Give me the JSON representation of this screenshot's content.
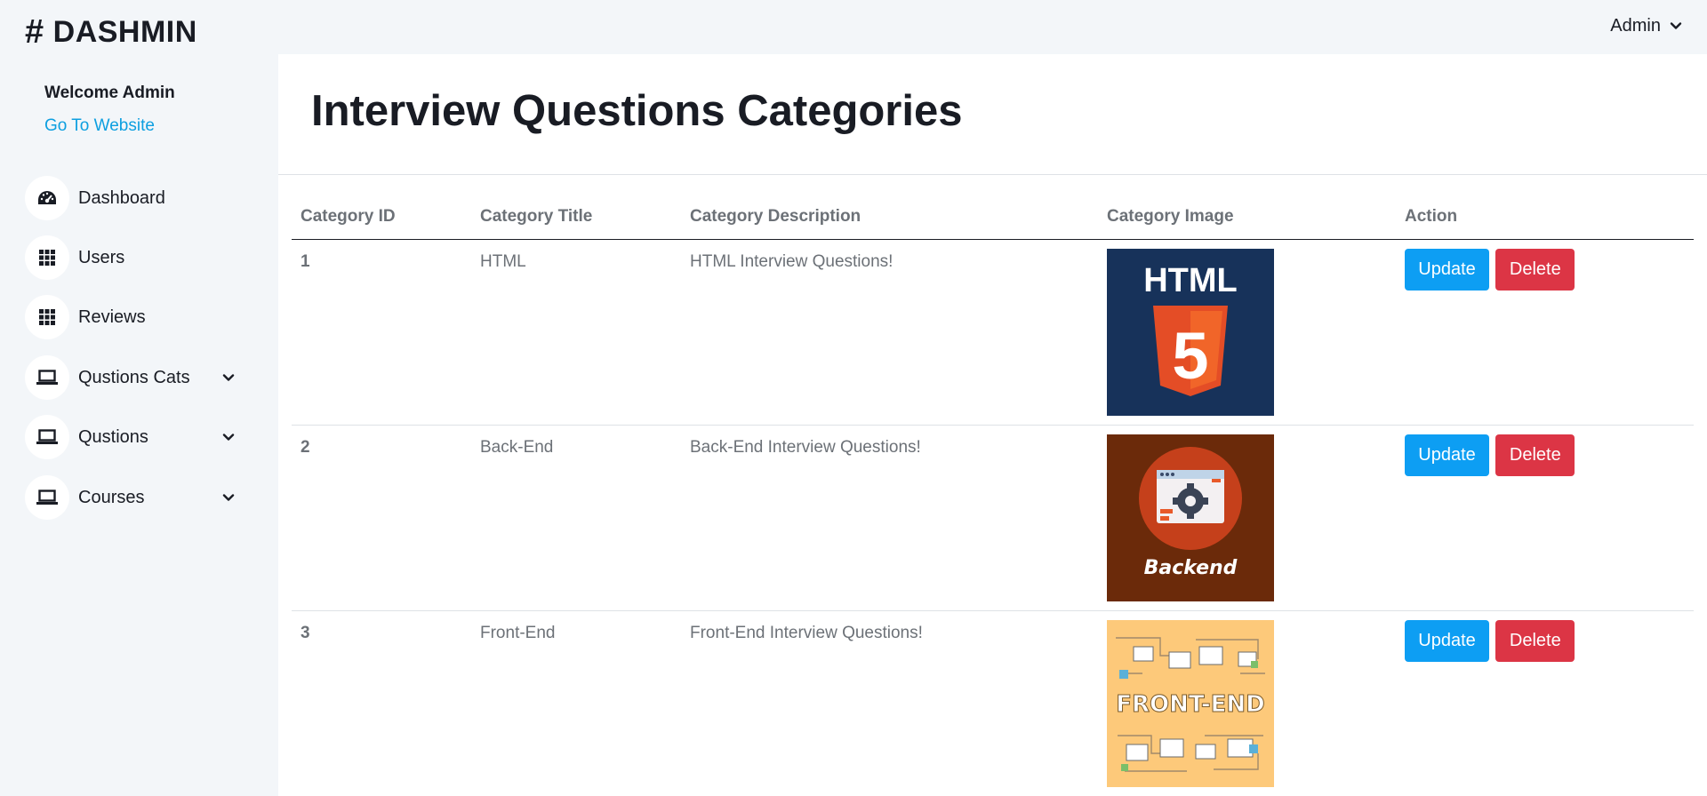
{
  "brand": {
    "hash": "#",
    "name": "DASHMIN"
  },
  "header": {
    "user_label": "Admin"
  },
  "sidebar": {
    "welcome": "Welcome Admin",
    "go_to_website": "Go To Website",
    "items": [
      {
        "label": "Dashboard",
        "icon": "speedometer-icon",
        "dropdown": false
      },
      {
        "label": "Users",
        "icon": "grid-icon",
        "dropdown": false
      },
      {
        "label": "Reviews",
        "icon": "grid-icon",
        "dropdown": false
      },
      {
        "label": "Qustions Cats",
        "icon": "laptop-icon",
        "dropdown": true
      },
      {
        "label": "Qustions",
        "icon": "laptop-icon",
        "dropdown": true
      },
      {
        "label": "Courses",
        "icon": "laptop-icon",
        "dropdown": true
      }
    ]
  },
  "main": {
    "title": "Interview Questions Categories",
    "table": {
      "headers": [
        "Category ID",
        "Category Title",
        "Category Description",
        "Category Image",
        "Action"
      ],
      "rows": [
        {
          "id": "1",
          "title": "HTML",
          "description": "HTML Interview Questions!",
          "image_text": "HTML",
          "image_badge": "5"
        },
        {
          "id": "2",
          "title": "Back-End",
          "description": "Back-End Interview Questions!",
          "image_text": "Backend"
        },
        {
          "id": "3",
          "title": "Front-End",
          "description": "Front-End Interview Questions!",
          "image_text": "FRONT-END"
        }
      ],
      "actions": {
        "update": "Update",
        "delete": "Delete"
      }
    }
  },
  "colors": {
    "accent_blue": "#0d9ef3",
    "danger_red": "#dc3545",
    "link_blue": "#0d9fe0",
    "sidebar_bg": "#f3f6f9",
    "html_bg": "#17325a",
    "html_orange": "#e44d26",
    "backend_bg": "#6b2a0a",
    "frontend_bg": "#fdc97a"
  }
}
